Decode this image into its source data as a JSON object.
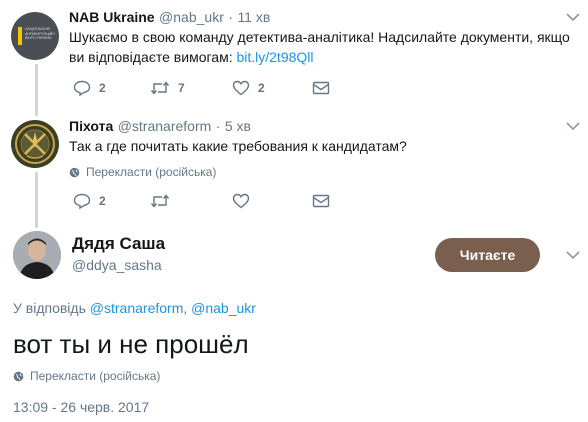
{
  "tweets": [
    {
      "name": "NAB Ukraine",
      "handle": "@nab_ukr",
      "time": "11 хв",
      "text": "Шукаємо в свою команду детектива-аналітика! Надсилайте документи, якщо ви відповідаєте вимогам: ",
      "link": "bit.ly/2t98Qll",
      "avatar_text": "НАЦІОНАЛЬНЕ АНТИКОРУПЦІЙНЕ БЮРО УКРАЇНИ",
      "actions": {
        "reply": "2",
        "retweet": "7",
        "like": "2"
      }
    },
    {
      "name": "Піхота",
      "handle": "@stranareform",
      "time": "5 хв",
      "text": "Так а где почитать какие требования к кандидатам?",
      "translate": "Перекласти (російська)",
      "actions": {
        "reply": "2",
        "retweet": "",
        "like": ""
      }
    }
  ],
  "main": {
    "name": "Дядя Саша",
    "handle": "@ddya_sasha",
    "follow_label": "Читаєте",
    "reply_prefix": "У відповідь",
    "reply_to_1": "@stranareform",
    "reply_sep": ",",
    "reply_to_2": "@nab_ukr",
    "text": "вот ты и не прошёл",
    "translate": "Перекласти (російська)",
    "timestamp": "13:09 - 26 черв. 2017"
  },
  "colors": {
    "accent": "#1b95e0",
    "follow_button": "#7a5e4e",
    "secondary_text": "#657786",
    "nab_avatar_bg": "#4a4f54",
    "nab_avatar_stripe": "#f5c400"
  },
  "icons": {
    "reply": "reply-icon",
    "retweet": "retweet-icon",
    "like": "heart-icon",
    "dm": "envelope-icon",
    "more": "chevron-down-icon",
    "translate": "globe-icon"
  }
}
